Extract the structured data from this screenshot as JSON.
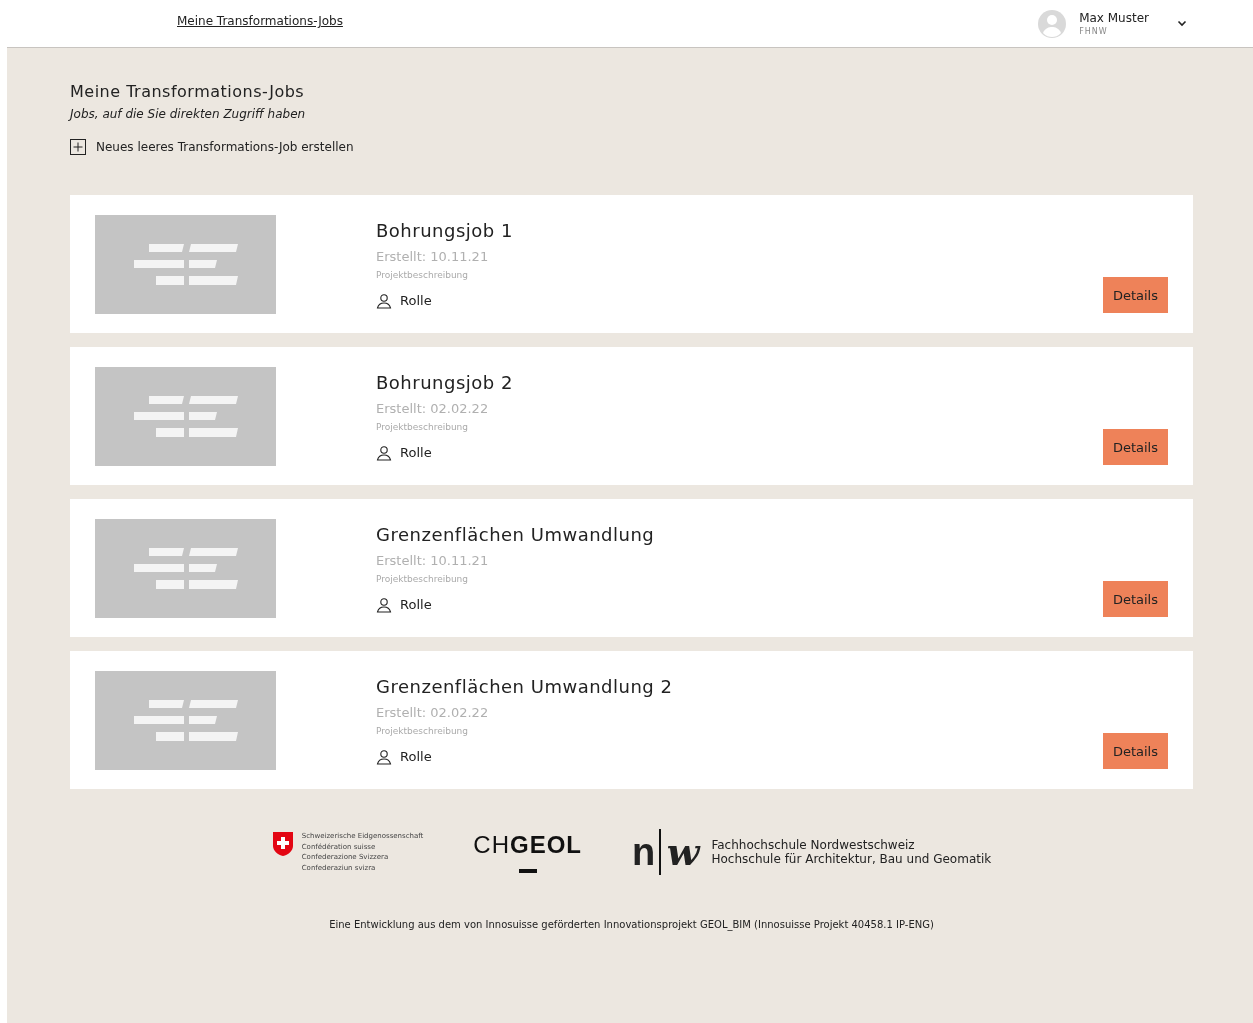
{
  "header": {
    "nav_link": "Meine Transformations-Jobs",
    "user": {
      "name": "Max Muster",
      "org": "FHNW"
    }
  },
  "page": {
    "title": "Meine Transformations-Jobs",
    "subtitle": "Jobs, auf die Sie direkten Zugriff haben",
    "create_action": "Neues leeres Transformations-Job erstellen"
  },
  "jobs": [
    {
      "title": "Bohrungsjob 1",
      "created": "Erstellt: 10.11.21",
      "description": "Projektbeschreibung",
      "role": "Rolle",
      "button": "Details"
    },
    {
      "title": "Bohrungsjob 2",
      "created": "Erstellt: 02.02.22",
      "description": "Projektbeschreibung",
      "role": "Rolle",
      "button": "Details"
    },
    {
      "title": "Grenzenflächen Umwandlung",
      "created": "Erstellt: 10.11.21",
      "description": "Projektbeschreibung",
      "role": "Rolle",
      "button": "Details"
    },
    {
      "title": "Grenzenflächen Umwandlung 2",
      "created": "Erstellt: 02.02.22",
      "description": "Projektbeschreibung",
      "role": "Rolle",
      "button": "Details"
    }
  ],
  "footer": {
    "logos": {
      "swiss": [
        "Schweizerische Eidgenossenschaft",
        "Confédération suisse",
        "Confederazione Svizzera",
        "Confederaziun svizra"
      ],
      "chgeol": "CH**GEOL**",
      "fhnw_mark": [
        "n",
        "w"
      ],
      "fhnw_text": [
        "Fachhochschule Nordwestschweiz",
        "Hochschule für Architektur, Bau und Geomatik"
      ]
    },
    "note": "Eine Entwicklung aus dem von Innosuisse geförderten Innovationsprojekt GEOL_BIM (Innosuisse Projekt 40458.1 IP-ENG)"
  }
}
